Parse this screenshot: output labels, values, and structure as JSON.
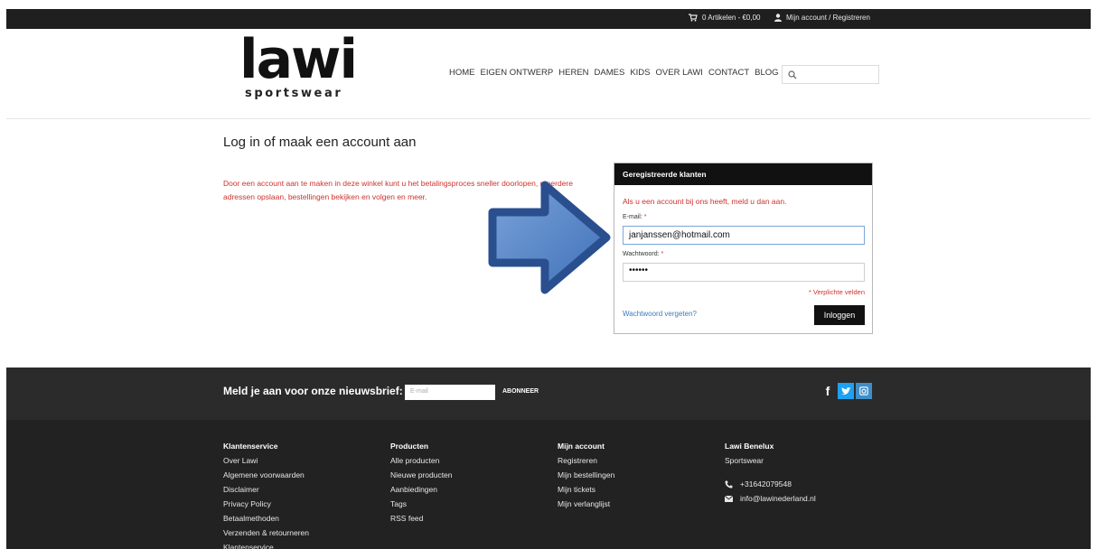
{
  "topbar": {
    "cart_label": "0 Artikelen - €0,00",
    "account_label": "Mijn account / Registreren"
  },
  "logo": {
    "main": "lawi",
    "sub": "sportswear"
  },
  "nav": [
    "HOME",
    "EIGEN ONTWERP",
    "HEREN",
    "DAMES",
    "KIDS",
    "OVER LAWI",
    "CONTACT",
    "BLOG"
  ],
  "search": {
    "placeholder": ""
  },
  "main": {
    "title": "Log in of maak een account aan",
    "intro": "Door een account aan te maken in deze winkel kunt u het betalingsproces sneller doorlopen, meerdere adressen opslaan, bestellingen bekijken en volgen en meer."
  },
  "login": {
    "heading": "Geregistreerde klanten",
    "note": "Als u een account bij ons heeft, meld u dan aan.",
    "email_label": "E-mail:",
    "email_value": "janjanssen@hotmail.com",
    "password_label": "Wachtwoord:",
    "password_value": "••••••",
    "required_star": "*",
    "required_note": "* Verplichte velden",
    "forgot_link": "Wachtwoord vergeten?",
    "login_button": "Inloggen"
  },
  "newsletter": {
    "label": "Meld je aan voor onze nieuwsbrief:",
    "placeholder": "E-mail",
    "button": "ABONNEER"
  },
  "footer": {
    "col1": {
      "title": "Klantenservice",
      "items": [
        "Over Lawi",
        "Algemene voorwaarden",
        "Disclaimer",
        "Privacy Policy",
        "Betaalmethoden",
        "Verzenden & retourneren",
        "Klantenservice"
      ]
    },
    "col2": {
      "title": "Producten",
      "items": [
        "Alle producten",
        "Nieuwe producten",
        "Aanbiedingen",
        "Tags",
        "RSS feed"
      ]
    },
    "col3": {
      "title": "Mijn account",
      "items": [
        "Registreren",
        "Mijn bestellingen",
        "Mijn tickets",
        "Mijn verlanglijst"
      ]
    },
    "col4": {
      "title": "Lawi Benelux",
      "subtitle": "Sportswear",
      "phone": "+31642079548",
      "email": "info@lawinederland.nl"
    }
  },
  "colors": {
    "accent_red": "#d0312d",
    "arrow_blue": "#3a62a8",
    "link_blue": "#3b7bbf",
    "dark": "#111111"
  }
}
